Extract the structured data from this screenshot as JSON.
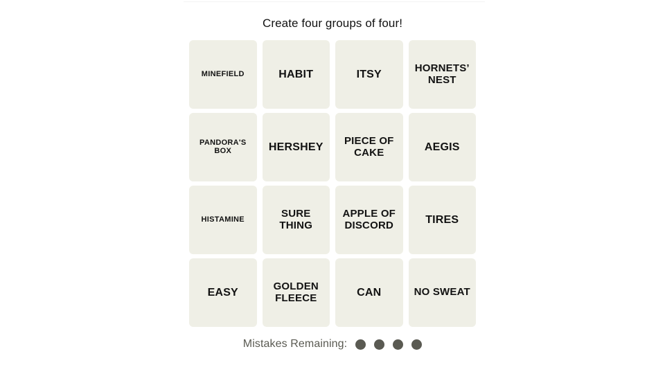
{
  "game": {
    "instructions": "Create four groups of four!",
    "tiles": [
      {
        "label": "MINEFIELD",
        "size": "sm"
      },
      {
        "label": "HABIT",
        "size": "lg"
      },
      {
        "label": "ITSY",
        "size": "lg"
      },
      {
        "label": "HORNETS’ NEST",
        "size": "md"
      },
      {
        "label": "PANDORA'S BOX",
        "size": "sm"
      },
      {
        "label": "HERSHEY",
        "size": "lg"
      },
      {
        "label": "PIECE OF CAKE",
        "size": "md"
      },
      {
        "label": "AEGIS",
        "size": "lg"
      },
      {
        "label": "HISTAMINE",
        "size": "sm"
      },
      {
        "label": "SURE THING",
        "size": "md"
      },
      {
        "label": "APPLE OF DISCORD",
        "size": "md"
      },
      {
        "label": "TIRES",
        "size": "lg"
      },
      {
        "label": "EASY",
        "size": "lg"
      },
      {
        "label": "GOLDEN FLEECE",
        "size": "md"
      },
      {
        "label": "CAN",
        "size": "lg"
      },
      {
        "label": "NO SWEAT",
        "size": "md"
      }
    ],
    "footer": {
      "mistakes_label": "Mistakes Remaining:",
      "mistakes_remaining": 4,
      "dot_color": "#5a5a52"
    },
    "colors": {
      "page_background": "#ffffff",
      "tile_background": "#efefe6",
      "tile_text": "#121212",
      "instructions_text": "#121212",
      "footer_text": "#5a5a52",
      "hairline": "#f4f4f4"
    }
  }
}
